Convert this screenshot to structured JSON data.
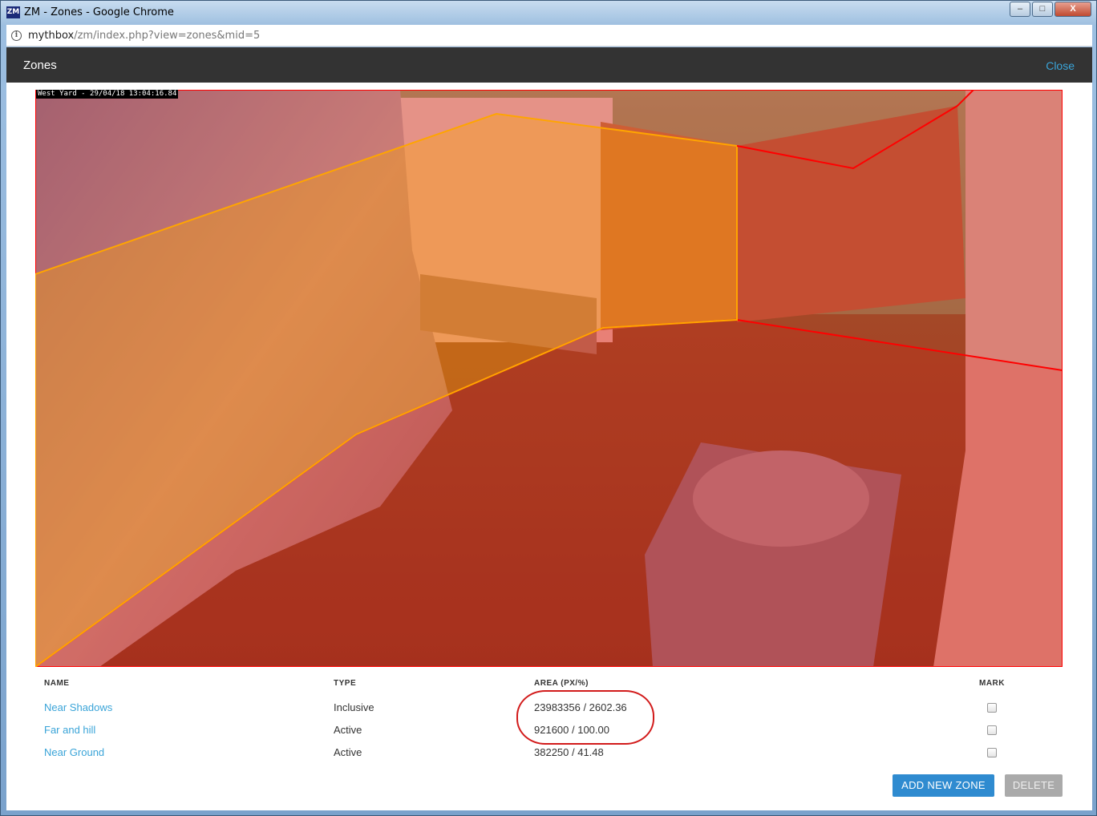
{
  "window": {
    "logo": "ZM",
    "title": "ZM - Zones - Google Chrome",
    "minimize": "–",
    "maximize": "□",
    "close": "X"
  },
  "address": {
    "host": "mythbox",
    "path": "/zm/index.php?view=zones&mid=5"
  },
  "page": {
    "title": "Zones",
    "close_label": "Close"
  },
  "camera": {
    "timestamp": "West Yard - 29/04/18 13:04:16.84"
  },
  "table": {
    "headers": {
      "name": "NAME",
      "type": "TYPE",
      "area": "AREA (PX/%)",
      "mark": "MARK"
    },
    "rows": [
      {
        "name": "Near Shadows",
        "type": "Inclusive",
        "area": "23983356 / 2602.36"
      },
      {
        "name": "Far and hill",
        "type": "Active",
        "area": "921600 / 100.00"
      },
      {
        "name": "Near Ground",
        "type": "Active",
        "area": "382250 / 41.48"
      }
    ]
  },
  "buttons": {
    "add": "ADD NEW ZONE",
    "delete": "DELETE"
  },
  "colors": {
    "zone_active": "#ff0000",
    "zone_inclusive": "#ffa500",
    "link": "#3aa4d8",
    "header_bg": "#333333"
  }
}
